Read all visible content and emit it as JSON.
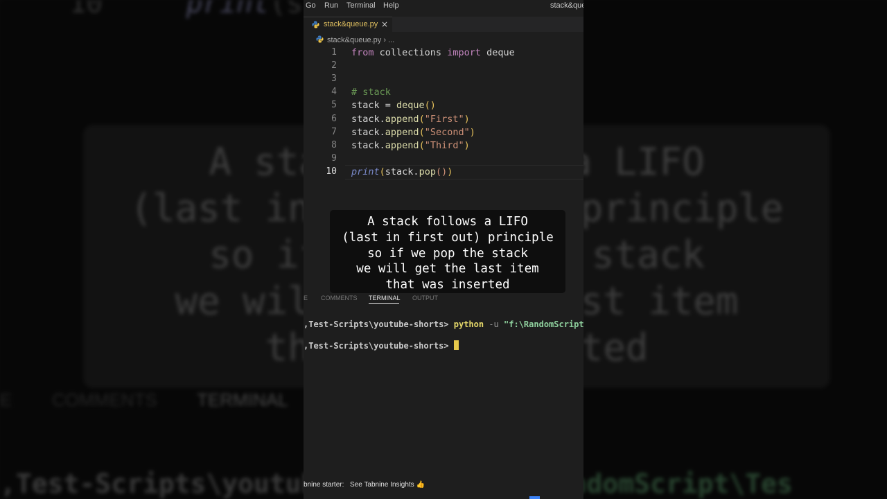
{
  "menubar": {
    "items": [
      "Go",
      "Run",
      "Terminal",
      "Help"
    ],
    "title": "stack&que"
  },
  "tab": {
    "filename": "stack&queue.py",
    "close_icon": "×",
    "icon": "python-file-icon"
  },
  "breadcrumb": {
    "filename": "stack&queue.py",
    "ellipsis": "..."
  },
  "editor": {
    "current_line": 10,
    "line_numbers": [
      "1",
      "2",
      "3",
      "4",
      "5",
      "6",
      "7",
      "8",
      "9",
      "10"
    ],
    "lines": [
      {
        "parts": [
          [
            "kw",
            "from"
          ],
          [
            "pl",
            " collections "
          ],
          [
            "kw",
            "import"
          ],
          [
            "pl",
            " deque"
          ]
        ]
      },
      {
        "parts": []
      },
      {
        "parts": []
      },
      {
        "parts": [
          [
            "cmt",
            "# stack"
          ]
        ]
      },
      {
        "parts": [
          [
            "pl",
            "stack = "
          ],
          [
            "fn",
            "deque"
          ],
          [
            "par",
            "()"
          ]
        ]
      },
      {
        "parts": [
          [
            "pl",
            "stack."
          ],
          [
            "fn",
            "append"
          ],
          [
            "par",
            "("
          ],
          [
            "str",
            "\"First\""
          ],
          [
            "par",
            ")"
          ]
        ]
      },
      {
        "parts": [
          [
            "pl",
            "stack."
          ],
          [
            "fn",
            "append"
          ],
          [
            "par",
            "("
          ],
          [
            "str",
            "\"Second\""
          ],
          [
            "par",
            ")"
          ]
        ]
      },
      {
        "parts": [
          [
            "pl",
            "stack."
          ],
          [
            "fn",
            "append"
          ],
          [
            "par",
            "("
          ],
          [
            "str",
            "\"Third\""
          ],
          [
            "par",
            ")"
          ]
        ]
      },
      {
        "parts": []
      },
      {
        "parts": [
          [
            "pr",
            "print"
          ],
          [
            "par",
            "("
          ],
          [
            "pl",
            "stack."
          ],
          [
            "fn",
            "pop"
          ],
          [
            "str",
            "()"
          ],
          [
            "par",
            ")"
          ]
        ]
      }
    ]
  },
  "caption": {
    "lines": [
      "A stack follows a LIFO",
      "(last in first out) principle",
      "so if we pop the stack",
      "we will get the last item",
      "that was inserted"
    ]
  },
  "panel": {
    "tabs": [
      "E",
      "COMMENTS",
      "TERMINAL",
      "OUTPUT"
    ],
    "active_tab": "TERMINAL"
  },
  "terminal": {
    "line1_prompt": ",Test-Scripts\\youtube-shorts> ",
    "line1_cmd": "python",
    "line1_flag": " -u ",
    "line1_arg": "\"f:\\RandomScript\\Tes",
    "line2_prompt": ",Test-Scripts\\youtube-shorts> "
  },
  "statusbar": {
    "left": "bnine starter:",
    "insights": "See Tabnine Insights 👍"
  },
  "colors": {
    "editor_bg": "#1e1e1e",
    "keyword": "#c586c0",
    "function": "#dcdcaa",
    "string": "#ce9178",
    "comment": "#6a9955",
    "tab_label": "#e0c060",
    "cursor": "#e6c84b"
  }
}
